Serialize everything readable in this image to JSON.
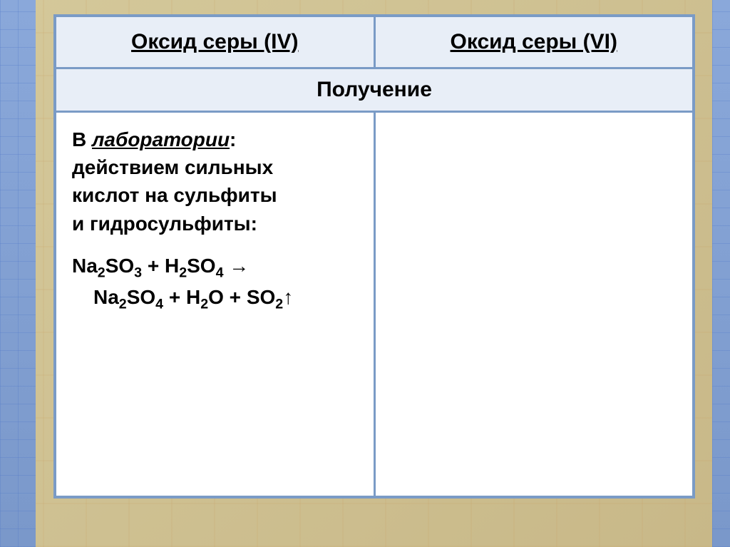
{
  "table": {
    "headers": {
      "left": "Оксид серы (IV)",
      "right": "Оксид серы (VI)"
    },
    "subheader": "Получение",
    "content": {
      "left": {
        "lab_label": "лаборатории",
        "in_prefix": "В ",
        "colon": ":",
        "description_line1": "действием сильных",
        "description_line2": "кислот на сульфиты",
        "description_line3": "и гидросульфиты:",
        "equation": {
          "line1_parts": {
            "na": "Na",
            "sub2": "2",
            "so": "SO",
            "sub3": "3",
            "plus1": " + H",
            "sub2b": "2",
            "so4": "SO",
            "sub4": "4",
            "arrow": " →"
          },
          "line2_parts": {
            "na": "Na",
            "sub2": "2",
            "so": "SO",
            "sub4": "4",
            "plus1": " + H",
            "sub2b": "2",
            "o": "O + SO",
            "sub2c": "2",
            "up": "↑"
          }
        }
      },
      "right": ""
    }
  }
}
